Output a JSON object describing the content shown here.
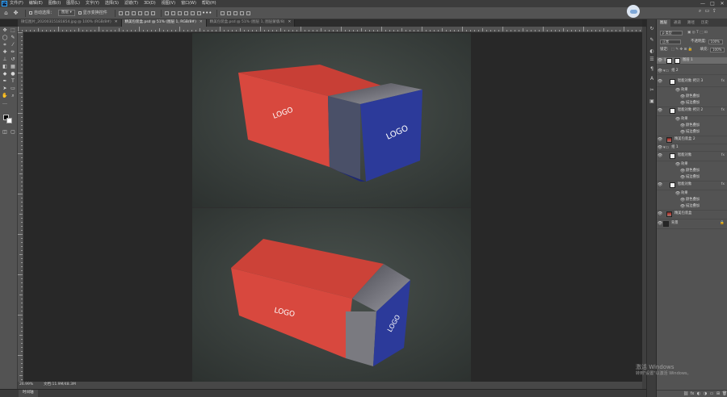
{
  "app": {
    "logo": "Ps",
    "menu": [
      "文件(F)",
      "编辑(E)",
      "图像(I)",
      "图层(L)",
      "文字(Y)",
      "选择(S)",
      "滤镜(T)",
      "3D(D)",
      "视图(V)",
      "窗口(W)",
      "帮助(H)"
    ],
    "window_controls": [
      "—",
      "□",
      "✕"
    ]
  },
  "options": {
    "auto_select_label": "自动选择：",
    "auto_select_value": "图层",
    "transform_label": "显示变换控件",
    "more": "•••"
  },
  "tabs": [
    {
      "label": "微信图片_20200315181854.jpg @ 100% (RGB/8#)",
      "close": "✕"
    },
    {
      "label": "精美包装盒.psd @ 51% (图层 1, RGB/8#)",
      "close": "✕"
    },
    {
      "label": "精美包装盒.psd @ 51% (图层 1, 图层蒙版/8)",
      "close": "✕"
    }
  ],
  "status": {
    "zoom": "26.99%",
    "doc": "文档:11.9M/48.3M"
  },
  "timeline": "时间轴",
  "panel": {
    "tabs": [
      "图层",
      "通道",
      "路径",
      "历史"
    ],
    "filter": "ρ 类型",
    "blend_mode": "正常",
    "opacity_label": "不透明度:",
    "opacity_value": "100%",
    "lock_label": "锁定:",
    "fill_label": "填充:",
    "fill_value": "100%",
    "layers": [
      {
        "name": "图层 1",
        "kind": "mask",
        "selected": true
      },
      {
        "name": "组 2",
        "kind": "group"
      },
      {
        "name": "智能对象 拷贝 3",
        "kind": "smart",
        "fx": true
      },
      {
        "name": "效果",
        "kind": "effect"
      },
      {
        "name": "颜色叠加",
        "kind": "sub"
      },
      {
        "name": "描边叠加",
        "kind": "sub"
      },
      {
        "name": "智能对象 拷贝 2",
        "kind": "smart",
        "fx": true
      },
      {
        "name": "效果",
        "kind": "effect"
      },
      {
        "name": "颜色叠加",
        "kind": "sub"
      },
      {
        "name": "描边叠加",
        "kind": "sub"
      },
      {
        "name": "精美包装盒 2",
        "kind": "box"
      },
      {
        "name": "组 1",
        "kind": "group"
      },
      {
        "name": "智能对象",
        "kind": "smart",
        "fx": true
      },
      {
        "name": "效果",
        "kind": "effect"
      },
      {
        "name": "颜色叠加",
        "kind": "sub"
      },
      {
        "name": "描边叠加",
        "kind": "sub"
      },
      {
        "name": "智能对象",
        "kind": "smart",
        "fx": true
      },
      {
        "name": "效果",
        "kind": "effect"
      },
      {
        "name": "颜色叠加",
        "kind": "sub"
      },
      {
        "name": "描边叠加",
        "kind": "sub"
      },
      {
        "name": "精美包装盒",
        "kind": "box"
      },
      {
        "name": "背景",
        "kind": "bg"
      }
    ],
    "bottom_icons": [
      "⛓",
      "fx",
      "◐",
      "◑",
      "▭",
      "⊞",
      "🗑"
    ]
  },
  "canvas": {
    "logo_text": "LOGO"
  },
  "watermark": {
    "title": "激活 Windows",
    "subtitle": "转到\"设置\"以激活 Windows。"
  },
  "colors": {
    "box_red": "#d8483e",
    "box_blue": "#2c3a9a",
    "bg": "#3a403d"
  }
}
